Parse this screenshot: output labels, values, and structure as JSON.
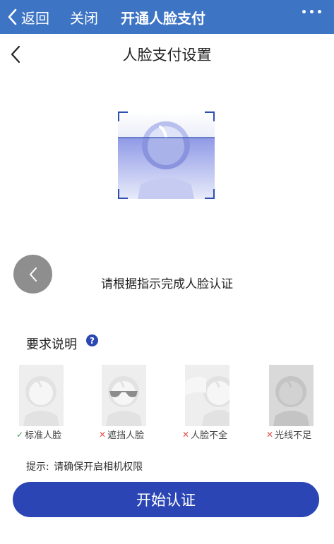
{
  "header": {
    "back_label": "返回",
    "close_label": "关闭",
    "title": "开通人脸支付",
    "more_icon": "more-icon",
    "color": "#3e74c4"
  },
  "nav": {
    "title": "人脸支付设置",
    "back_icon": "chevron-left-icon"
  },
  "instruction": "请根据指示完成人脸认证",
  "requirements": {
    "title": "要求说明",
    "help_symbol": "?",
    "items": [
      {
        "label": "标准人脸",
        "status": "ok",
        "mark": "✓"
      },
      {
        "label": "遮挡人脸",
        "status": "bad",
        "mark": "✕"
      },
      {
        "label": "人脸不全",
        "status": "bad",
        "mark": "✕"
      },
      {
        "label": "光线不足",
        "status": "bad",
        "mark": "✕"
      }
    ]
  },
  "hint": {
    "prefix": "提示:",
    "text": "请确保开启相机权限"
  },
  "start_button": "开始认证",
  "colors": {
    "accent": "#2b46b4",
    "header": "#3e74c4",
    "ok": "#3fa35a",
    "error": "#e55050"
  }
}
